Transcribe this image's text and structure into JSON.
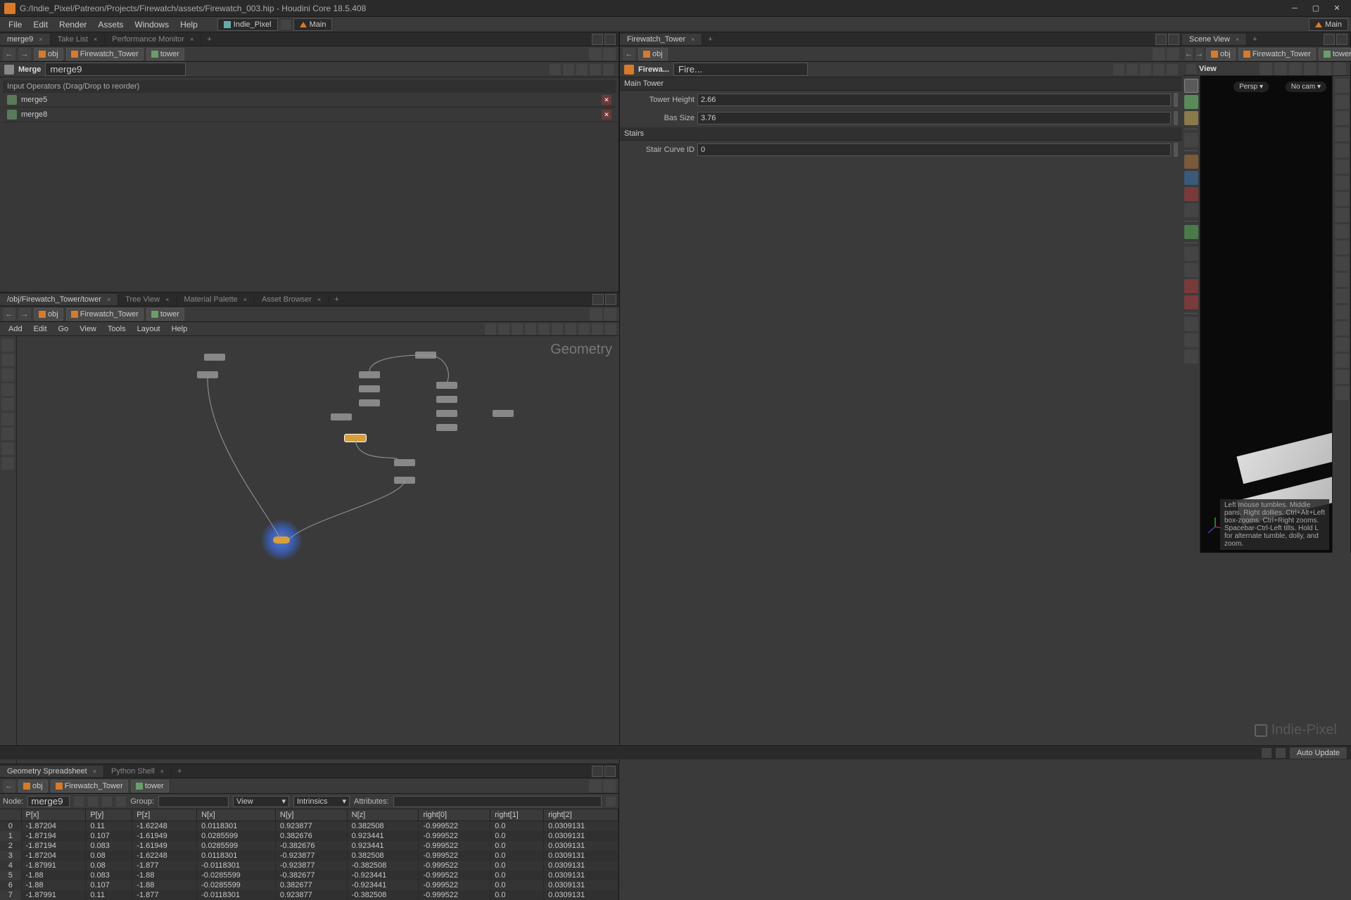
{
  "window": {
    "title": "G:/Indie_Pixel/Patreon/Projects/Firewatch/assets/Firewatch_003.hip - Houdini Core 18.5.408"
  },
  "menubar": {
    "items": [
      "File",
      "Edit",
      "Render",
      "Assets",
      "Windows",
      "Help"
    ],
    "desktop_label": "Indie_Pixel",
    "radial_label": "Main"
  },
  "scene_view": {
    "tab": "Scene View",
    "path": {
      "obj": "obj",
      "asset": "Firewatch_Tower",
      "node": "tower"
    },
    "view_label": "View",
    "persp": "Persp ▾",
    "cam": "No cam ▾",
    "hint": "Left mouse tumbles. Middle pans. Right dollies. Ctrl+Alt+Left box-zooms. Ctrl+Right zooms. Spacebar-Ctrl-Left tilts. Hold L for alternate tumble, dolly, and zoom."
  },
  "param_pane": {
    "tabs": [
      "merge9",
      "Take List",
      "Performance Monitor"
    ],
    "path": {
      "obj": "obj",
      "asset": "Firewatch_Tower",
      "node": "tower"
    },
    "node_type_icon": "merge",
    "node_type": "Merge",
    "node_name": "merge9",
    "input_ops_header": "Input Operators (Drag/Drop to reorder)",
    "inputs": [
      "merge5",
      "merge8"
    ]
  },
  "network": {
    "tabs": [
      "/obj/Firewatch_Tower/tower",
      "Tree View",
      "Material Palette",
      "Asset Browser"
    ],
    "path": {
      "obj": "obj",
      "asset": "Firewatch_Tower",
      "node": "tower"
    },
    "menu": [
      "Add",
      "Edit",
      "Go",
      "View",
      "Tools",
      "Layout",
      "Help"
    ],
    "context_label": "Geometry"
  },
  "right_panel": {
    "tabs": [
      "Firewatch_Tower"
    ],
    "path": {
      "obj": "obj"
    },
    "node_short": "Firewa...",
    "node_name": "Fire...",
    "sections": {
      "main_tower": {
        "title": "Main Tower",
        "tower_height": {
          "label": "Tower Height",
          "value": "2.66"
        },
        "bas_size": {
          "label": "Bas Size",
          "value": "3.76"
        }
      },
      "stairs": {
        "title": "Stairs",
        "stair_curve_id": {
          "label": "Stair Curve ID",
          "value": "0"
        }
      }
    }
  },
  "right_menubar_desktop": "Main",
  "spreadsheet": {
    "tabs": [
      "Geometry Spreadsheet",
      "Python Shell"
    ],
    "path": {
      "obj": "obj",
      "asset": "Firewatch_Tower",
      "node": "tower"
    },
    "node_label": "Node:",
    "node_value": "merge9",
    "group_label": "Group:",
    "view_label": "View",
    "intrinsics_label": "Intrinsics",
    "attributes_label": "Attributes:",
    "headers": [
      "",
      "P[x]",
      "P[y]",
      "P[z]",
      "N[x]",
      "N[y]",
      "N[z]",
      "right[0]",
      "right[1]",
      "right[2]"
    ],
    "rows": [
      [
        "0",
        "-1.87204",
        "0.11",
        "-1.62248",
        "0.0118301",
        "0.923877",
        "0.382508",
        "-0.999522",
        "0.0",
        "0.0309131"
      ],
      [
        "1",
        "-1.87194",
        "0.107",
        "-1.61949",
        "0.0285599",
        "0.382676",
        "0.923441",
        "-0.999522",
        "0.0",
        "0.0309131"
      ],
      [
        "2",
        "-1.87194",
        "0.083",
        "-1.61949",
        "0.0285599",
        "-0.382676",
        "0.923441",
        "-0.999522",
        "0.0",
        "0.0309131"
      ],
      [
        "3",
        "-1.87204",
        "0.08",
        "-1.62248",
        "0.0118301",
        "-0.923877",
        "0.382508",
        "-0.999522",
        "0.0",
        "0.0309131"
      ],
      [
        "4",
        "-1.87991",
        "0.08",
        "-1.877",
        "-0.0118301",
        "-0.923877",
        "-0.382508",
        "-0.999522",
        "0.0",
        "0.0309131"
      ],
      [
        "5",
        "-1.88",
        "0.083",
        "-1.88",
        "-0.0285599",
        "-0.382677",
        "-0.923441",
        "-0.999522",
        "0.0",
        "0.0309131"
      ],
      [
        "6",
        "-1.88",
        "0.107",
        "-1.88",
        "-0.0285599",
        "0.382677",
        "-0.923441",
        "-0.999522",
        "0.0",
        "0.0309131"
      ],
      [
        "7",
        "-1.87991",
        "0.11",
        "-1.877",
        "-0.0118301",
        "0.923877",
        "-0.382508",
        "-0.999522",
        "0.0",
        "0.0309131"
      ]
    ]
  },
  "statusbar": {
    "auto_update": "Auto Update"
  },
  "brand": "Indie-Pixel"
}
